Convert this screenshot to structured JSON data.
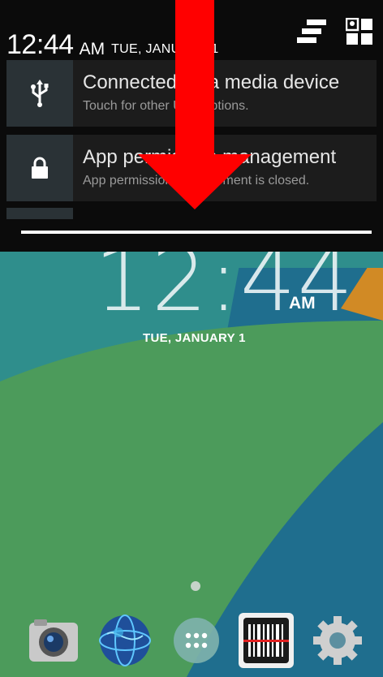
{
  "status_bar": {
    "time": "12:44",
    "ampm": "AM",
    "date": "TUE, JANUARY 1",
    "icons": [
      "quick-settings-icon",
      "user-profile-icon"
    ]
  },
  "notifications": [
    {
      "icon": "usb-icon",
      "title": "Connected as a media device",
      "subtitle": "Touch for other USB options."
    },
    {
      "icon": "lock-icon",
      "title": "App permission management",
      "subtitle": "App permission management is closed."
    }
  ],
  "lockscreen": {
    "time": "12:44",
    "ampm": "AM",
    "date": "TUE, JANUARY 1"
  },
  "dock": {
    "apps": [
      "camera-icon",
      "browser-icon",
      "all-apps-icon",
      "barcode-scanner-icon",
      "settings-icon"
    ]
  },
  "colors": {
    "arrow": "#ff0000",
    "shade_bg": "#0b0b0b",
    "wall_green": "#4a9a5a",
    "wall_teal": "#2e8f8f",
    "wall_blue": "#1f6d8c"
  }
}
